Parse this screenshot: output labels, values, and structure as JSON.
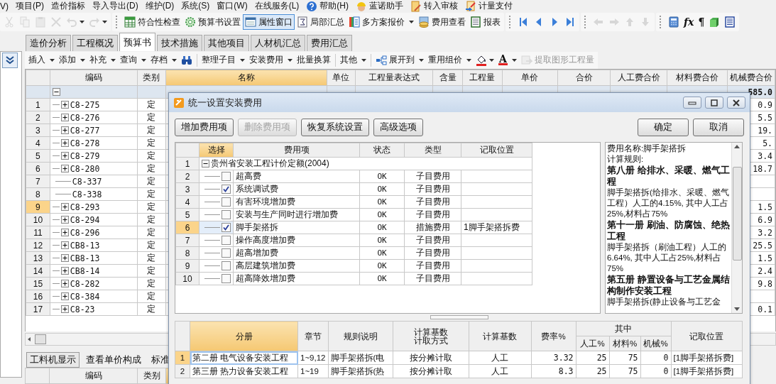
{
  "menu_bar": [
    {
      "label": "V)",
      "kind": "text"
    },
    {
      "label": "项目(P)",
      "kind": "text"
    },
    {
      "label": "造价指标",
      "kind": "text"
    },
    {
      "label": "导入导出(D)",
      "kind": "text"
    },
    {
      "label": "维护(D)",
      "kind": "text"
    },
    {
      "label": "系统(S)",
      "kind": "text"
    },
    {
      "label": "窗口(W)",
      "kind": "text"
    },
    {
      "label": "在线服务(L)",
      "kind": "text"
    },
    {
      "label": "帮助(H)",
      "kind": "help"
    },
    {
      "label": "蓝诺助手",
      "kind": "helper"
    },
    {
      "label": "转入审核",
      "kind": "review"
    },
    {
      "label": "计量支付",
      "kind": "pay"
    }
  ],
  "toolbar": {
    "edit_tools": [
      {
        "kind": "cut",
        "disabled": true,
        "dropdown": false
      },
      {
        "kind": "copy",
        "disabled": true,
        "dropdown": false
      },
      {
        "kind": "paste",
        "disabled": true,
        "dropdown": false
      },
      {
        "kind": "delete",
        "disabled": true,
        "dropdown": false
      },
      {
        "kind": "undo",
        "disabled": true,
        "dropdown": true
      },
      {
        "kind": "redo",
        "disabled": true,
        "dropdown": true
      }
    ],
    "buttons": [
      {
        "label": "符合性检查",
        "kind": "sheet",
        "selected": false,
        "dropdown": false
      },
      {
        "label": "预算书设置",
        "kind": "gear",
        "selected": false,
        "dropdown": false
      },
      {
        "label": "属性窗口",
        "kind": "window",
        "selected": true,
        "dropdown": false
      },
      {
        "label": "局部汇总",
        "kind": "sum",
        "selected": false,
        "dropdown": false
      },
      {
        "label": "多方案报价",
        "kind": "scheme",
        "selected": false,
        "dropdown": true
      },
      {
        "label": "费用查看",
        "kind": "coins",
        "selected": false,
        "dropdown": false
      },
      {
        "label": "报表",
        "kind": "report",
        "selected": false,
        "dropdown": false
      }
    ],
    "nav_tools": [
      {
        "kind": "first",
        "disabled": false
      },
      {
        "kind": "prev",
        "disabled": false
      },
      {
        "kind": "next",
        "disabled": false
      },
      {
        "kind": "last",
        "disabled": false
      }
    ],
    "move_tools": [
      {
        "kind": "left",
        "disabled": true
      },
      {
        "kind": "right",
        "disabled": true
      },
      {
        "kind": "up",
        "disabled": true
      },
      {
        "kind": "down",
        "disabled": true
      }
    ],
    "extra_tools": [
      {
        "kind": "calc"
      },
      {
        "kind": "fx",
        "label": "fx"
      },
      {
        "kind": "pilcrow",
        "label": "¶"
      },
      {
        "kind": "cube"
      },
      {
        "kind": "list"
      }
    ]
  },
  "tabs": [
    {
      "label": "造价分析",
      "selected": false
    },
    {
      "label": "工程概况",
      "selected": false
    },
    {
      "label": "预算书",
      "selected": true
    },
    {
      "label": "技术措施",
      "selected": false
    },
    {
      "label": "其他项目",
      "selected": false
    },
    {
      "label": "人材机汇总",
      "selected": false
    },
    {
      "label": "费用汇总",
      "selected": false
    }
  ],
  "sub_toolbar": [
    {
      "label": "插入",
      "kind": "text",
      "dropdown": true,
      "disabled": false
    },
    {
      "label": "添加",
      "kind": "text",
      "dropdown": true,
      "disabled": false
    },
    {
      "label": "补充",
      "kind": "text",
      "dropdown": true,
      "disabled": false
    },
    {
      "label": "查询",
      "kind": "text",
      "dropdown": true,
      "disabled": false
    },
    {
      "label": "存档",
      "kind": "text",
      "dropdown": true,
      "disabled": false
    },
    {
      "kind": "binoculars",
      "dropdown": false,
      "disabled": false
    },
    {
      "kind": "separator"
    },
    {
      "label": "整理子目",
      "kind": "text",
      "dropdown": true,
      "disabled": false
    },
    {
      "label": "安装费用",
      "kind": "text",
      "dropdown": true,
      "disabled": false
    },
    {
      "label": "批量换算",
      "kind": "text",
      "dropdown": false,
      "disabled": false
    },
    {
      "kind": "separator"
    },
    {
      "label": "其他",
      "kind": "text",
      "dropdown": true,
      "disabled": false
    },
    {
      "kind": "separator"
    },
    {
      "label": "展开到",
      "kind": "tree",
      "dropdown": true,
      "disabled": false
    },
    {
      "label": "重用组价",
      "kind": "text",
      "dropdown": true,
      "disabled": false
    },
    {
      "kind": "fill-color",
      "dropdown": true,
      "disabled": false
    },
    {
      "label": "A",
      "kind": "font-color",
      "dropdown": true,
      "disabled": false
    },
    {
      "label": "提取图形工程量",
      "kind": "extract",
      "dropdown": false,
      "disabled": true
    }
  ],
  "main_table": {
    "columns": [
      {
        "label": "编码",
        "selected": false
      },
      {
        "label": "类别",
        "selected": false
      },
      {
        "label": "名称",
        "selected": true
      },
      {
        "label": "单位",
        "selected": false
      },
      {
        "label": "工程量表达式",
        "selected": false
      },
      {
        "label": "含量",
        "selected": false
      },
      {
        "label": "工程量",
        "selected": false
      },
      {
        "label": "单价",
        "selected": false
      },
      {
        "label": "合价",
        "selected": false
      },
      {
        "label": "人工费合价",
        "selected": false
      },
      {
        "label": "材料费合价",
        "selected": false
      },
      {
        "label": "机械费合价",
        "selected": false
      }
    ],
    "rows": [
      {
        "kind": "root",
        "expanded": true,
        "selected": false,
        "machine_total": "585.0"
      },
      {
        "number": "1",
        "code": "C8-275",
        "category": "定",
        "kind": "group",
        "expanded": false,
        "selected": false,
        "machine_total": "0.9"
      },
      {
        "number": "2",
        "code": "C8-276",
        "category": "定",
        "kind": "group",
        "expanded": false,
        "selected": false,
        "machine_total": "5.5"
      },
      {
        "number": "3",
        "code": "C8-277",
        "category": "定",
        "kind": "group",
        "expanded": false,
        "selected": false,
        "machine_total": "19."
      },
      {
        "number": "4",
        "code": "C8-278",
        "category": "定",
        "kind": "group",
        "expanded": false,
        "selected": false,
        "machine_total": "5."
      },
      {
        "number": "5",
        "code": "C8-279",
        "category": "定",
        "kind": "group",
        "expanded": false,
        "selected": false,
        "machine_total": "3.4"
      },
      {
        "number": "6",
        "code": "C8-280",
        "category": "定",
        "kind": "group",
        "expanded": false,
        "selected": false,
        "machine_total": "18.7"
      },
      {
        "number": "7",
        "code": "C8-337",
        "category": "定",
        "kind": "leaf",
        "selected": false
      },
      {
        "number": "8",
        "code": "C8-338",
        "category": "定",
        "kind": "leaf",
        "selected": false
      },
      {
        "number": "9",
        "code": "C8-293",
        "category": "定",
        "kind": "group",
        "expanded": false,
        "selected": true,
        "machine_total": "1.5"
      },
      {
        "number": "10",
        "code": "C8-294",
        "category": "定",
        "kind": "group",
        "expanded": false,
        "selected": false,
        "machine_total": "6.9"
      },
      {
        "number": "11",
        "code": "C8-296",
        "category": "定",
        "kind": "group",
        "expanded": false,
        "selected": false,
        "machine_total": "3.2"
      },
      {
        "number": "12",
        "code": "CB8-13",
        "category": "定",
        "kind": "group",
        "expanded": false,
        "selected": false,
        "machine_total": "25.5"
      },
      {
        "number": "13",
        "code": "CB8-13",
        "category": "定",
        "kind": "group",
        "expanded": false,
        "selected": false,
        "machine_total": "1.5"
      },
      {
        "number": "14",
        "code": "CB8-14",
        "category": "定",
        "kind": "group",
        "expanded": false,
        "selected": false,
        "machine_total": "2.4"
      },
      {
        "number": "15",
        "code": "C8-282",
        "category": "定",
        "kind": "group",
        "expanded": false,
        "selected": false,
        "machine_total": "9.8"
      },
      {
        "number": "16",
        "code": "C8-384",
        "category": "定",
        "kind": "group",
        "expanded": false,
        "selected": false
      },
      {
        "number": "17",
        "code": "C8-23",
        "category": "定",
        "kind": "group",
        "expanded": false,
        "selected": false,
        "machine_total": "0.1"
      }
    ]
  },
  "bottom_tabs": [
    {
      "label": "工料机显示",
      "selected": true
    },
    {
      "label": "查看单价构成",
      "selected": false
    },
    {
      "label": "标准",
      "selected": false
    }
  ],
  "bottom_table": {
    "columns": [
      {
        "label": "编码",
        "selected": false
      },
      {
        "label": "类别",
        "selected": false
      },
      {
        "selected": true
      }
    ]
  },
  "dialog": {
    "title": "统一设置安装费用",
    "buttons": [
      {
        "label": "增加费用项",
        "disabled": false
      },
      {
        "label": "删除费用项",
        "disabled": true
      },
      {
        "label": "恢复系统设置",
        "disabled": false
      },
      {
        "label": "高级选项",
        "disabled": false
      }
    ],
    "confirm_buttons": [
      {
        "label": "确定"
      },
      {
        "label": "取消"
      }
    ],
    "fee_table": {
      "columns": [
        {
          "label": "选择",
          "selected": true
        },
        {
          "label": "费用项",
          "selected": false
        },
        {
          "label": "状态",
          "selected": false
        },
        {
          "label": "类型",
          "selected": false
        },
        {
          "label": "记取位置",
          "selected": false
        }
      ],
      "root": {
        "number": "1",
        "label": "贵州省安装工程计价定额(2004)",
        "expanded": true
      },
      "items": [
        {
          "number": "2",
          "name": "超高费",
          "checked": false,
          "status": "OK",
          "type": "子目费用",
          "selected": false
        },
        {
          "number": "3",
          "name": "系统调试费",
          "checked": true,
          "status": "OK",
          "type": "子目费用",
          "selected": false
        },
        {
          "number": "4",
          "name": "有害环境增加费",
          "checked": false,
          "status": "OK",
          "type": "子目费用",
          "selected": false
        },
        {
          "number": "5",
          "name": "安装与生产同时进行增加费",
          "checked": false,
          "status": "OK",
          "type": "子目费用",
          "selected": false
        },
        {
          "number": "6",
          "name": "脚手架搭拆",
          "checked": true,
          "status": "OK",
          "type": "措施费用",
          "position": "1脚手架搭拆费",
          "selected": true
        },
        {
          "number": "7",
          "name": "操作高度增加费",
          "checked": false,
          "status": "OK",
          "type": "子目费用",
          "selected": false
        },
        {
          "number": "8",
          "name": "超高增加费",
          "checked": false,
          "status": "OK",
          "type": "子目费用",
          "selected": false
        },
        {
          "number": "9",
          "name": "高层建筑增加费",
          "checked": false,
          "status": "OK",
          "type": "子目费用",
          "selected": false
        },
        {
          "number": "10",
          "name": "超高降效增加费",
          "checked": false,
          "status": "OK",
          "type": "子目费用",
          "selected": false
        }
      ]
    },
    "rule_panel": [
      {
        "kind": "text",
        "text": "费用名称:脚手架搭拆"
      },
      {
        "kind": "text",
        "text": "计算规则:"
      },
      {
        "kind": "heading",
        "text": "第八册 给排水、采暖、燃气工程"
      },
      {
        "kind": "text",
        "text": "脚手架搭拆(给排水、采暖、燃气工程）人工的4.15%, 其中人工占25%,材料占75%"
      },
      {
        "kind": "heading",
        "text": "第十一册 刷油、防腐蚀、绝热工程"
      },
      {
        "kind": "text",
        "text": "脚手架搭拆（刷油工程）人工的6.64%, 其中人工占25%,材料占75%"
      },
      {
        "kind": "heading",
        "text": "第五册 静置设备与工艺金属结构制作安装工程"
      },
      {
        "kind": "text",
        "text": "脚手架搭拆(静止设备与工艺金"
      }
    ],
    "rate_table": {
      "headers": {
        "volume": "分册",
        "chapter": "章节",
        "rule": "规则说明",
        "method": "计算基数计取方式",
        "base": "计算基数",
        "rate": "费率%",
        "share": "其中",
        "labor": "人工%",
        "material": "材料%",
        "machine": "机械%",
        "position": "记取位置"
      },
      "rows": [
        {
          "number": "1",
          "volume": "第二册 电气设备安装工程",
          "chapter": "1~9,12",
          "rule": "脚手架搭拆(电",
          "method": "按分摊计取",
          "base": "人工",
          "rate": "3.32",
          "labor": "25",
          "material": "75",
          "machine": "0",
          "position": "[1脚手架搭拆费]",
          "selected": true
        },
        {
          "number": "2",
          "volume": "第三册 热力设备安装工程",
          "chapter": "1~19",
          "rule": "脚手架搭拆(热",
          "method": "按分摊计取",
          "base": "人工",
          "rate": "8.3",
          "labor": "25",
          "material": "75",
          "machine": "0",
          "position": "[1脚手架搭拆费]",
          "selected": false
        }
      ]
    }
  }
}
